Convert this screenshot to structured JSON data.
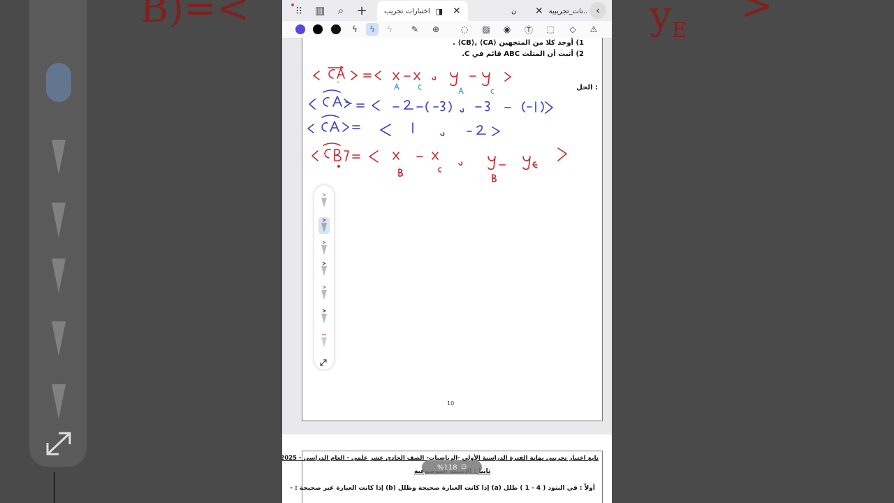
{
  "tabs": [
    {
      "label": "اختبارات تجريب",
      "active": true
    },
    {
      "label": "ن",
      "active": false
    },
    {
      "label": "نات_تجريبية..",
      "active": false
    }
  ],
  "toolbar_colors": [
    "#5a45e0",
    "#000000",
    "#111111"
  ],
  "worksheet": {
    "q1": "1) أوجد كلا من المتجهين ⟨CA⟩ ,⟨CB⟩ .",
    "q2": "2) أثبت أن المثلث ABC قائم في C.",
    "solution_label": "الحل :",
    "page_number": "10"
  },
  "page2": {
    "header": "تابع اختبار تجريبي نهاية الفترة الدراسية الأولى -الرياضيات- الصف الحادي عشر علمي - العام الدراسي - 2026/2025م",
    "section": "ثانيا : الأسئلة الموضوعية",
    "instruction": "أولاً : في البنود ( 4 - 1 ) ظلل (a) إذا كانت العبارة صحيحة وظلل (b) إذا كانت العبارة غير صحيحة : -"
  },
  "zoom": {
    "label": "%118"
  },
  "handwriting": {
    "line1": "<CA> = < x_A - x_C , y_A - y_C >",
    "line2": "<CA> = < -2-(-3) , -3 - (-1) >",
    "line3": "<CA> = < 1 , -2 >",
    "line4": "<CB> = < x_B - x_C , y_B - y_C >"
  }
}
